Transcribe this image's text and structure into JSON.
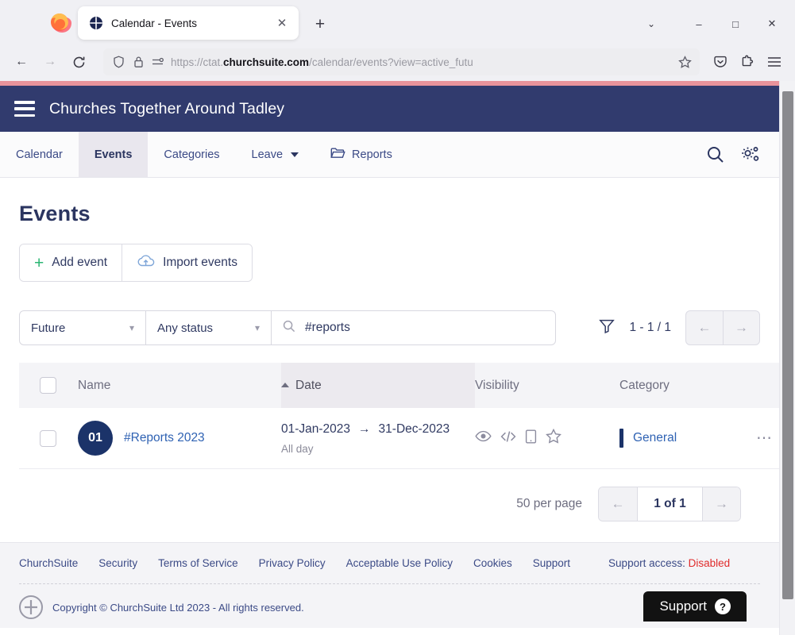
{
  "browser": {
    "tab": {
      "title": "Calendar - Events",
      "favicon": "churchsuite-cross-icon",
      "close_label": "✕"
    },
    "new_tab_label": "+",
    "window_controls": {
      "list_all_tabs": "⌄",
      "minimize": "–",
      "maximize": "□",
      "close": "✕"
    },
    "nav": {
      "back": "←",
      "forward": "→",
      "reload": "↻"
    },
    "url": {
      "prefix": "https://ctat.",
      "domain": "churchsuite.com",
      "path": "/calendar/events?view=active_futu"
    },
    "toolbar_icons": [
      "pocket-icon",
      "extensions-icon",
      "app-menu-icon"
    ]
  },
  "app": {
    "org_title": "Churches Together Around Tadley",
    "nav_tabs": [
      {
        "label": "Calendar",
        "active": false
      },
      {
        "label": "Events",
        "active": true
      },
      {
        "label": "Categories",
        "active": false
      },
      {
        "label": "Leave",
        "active": false,
        "has_caret": true
      },
      {
        "label": "Reports",
        "active": false,
        "has_folder_icon": true
      }
    ],
    "nav_right_icons": [
      "search-icon",
      "settings-gear-icon"
    ]
  },
  "main": {
    "page_title": "Events",
    "actions": [
      {
        "label": "Add event",
        "icon": "plus-icon"
      },
      {
        "label": "Import events",
        "icon": "cloud-upload-icon"
      }
    ],
    "filters": {
      "timeframe": {
        "value": "Future"
      },
      "status": {
        "value": "Any status"
      },
      "search": {
        "value": "#reports",
        "placeholder": "Search"
      },
      "funnel_icon": "filter-funnel-icon",
      "result_count": "1 - 1 / 1",
      "prev": "←",
      "next": "→"
    },
    "table": {
      "columns": [
        "Name",
        "Date",
        "Visibility",
        "Category"
      ],
      "sorted_column": "Date",
      "sort_direction": "asc",
      "rows": [
        {
          "badge": "01",
          "name": "#Reports 2023",
          "date_start": "01-Jan-2023",
          "date_end": "31-Dec-2023",
          "date_arrow": "→",
          "time": "All day",
          "visibility_icons": [
            "eye-icon",
            "embed-code-icon",
            "mobile-device-icon",
            "star-outline-icon"
          ],
          "category": "General",
          "category_color": "#1b3369",
          "row_menu": "⋯"
        }
      ]
    },
    "pagination": {
      "per_page": "50 per page",
      "page_label": "1 of 1",
      "prev": "←",
      "next": "→"
    }
  },
  "footer": {
    "links": [
      "ChurchSuite",
      "Security",
      "Terms of Service",
      "Privacy Policy",
      "Acceptable Use Policy",
      "Cookies",
      "Support"
    ],
    "support_access_label": "Support access:",
    "support_access_value": "Disabled",
    "copyright": "Copyright © ChurchSuite Ltd 2023 - All rights reserved.",
    "support_fab": {
      "label": "Support",
      "icon": "question-mark-icon"
    }
  },
  "colors": {
    "header_navy": "#313b6e",
    "accent_blue": "#2f62b3",
    "green": "#2bb673",
    "red": "#e02b2b",
    "loading_bar": "#e8939b"
  }
}
